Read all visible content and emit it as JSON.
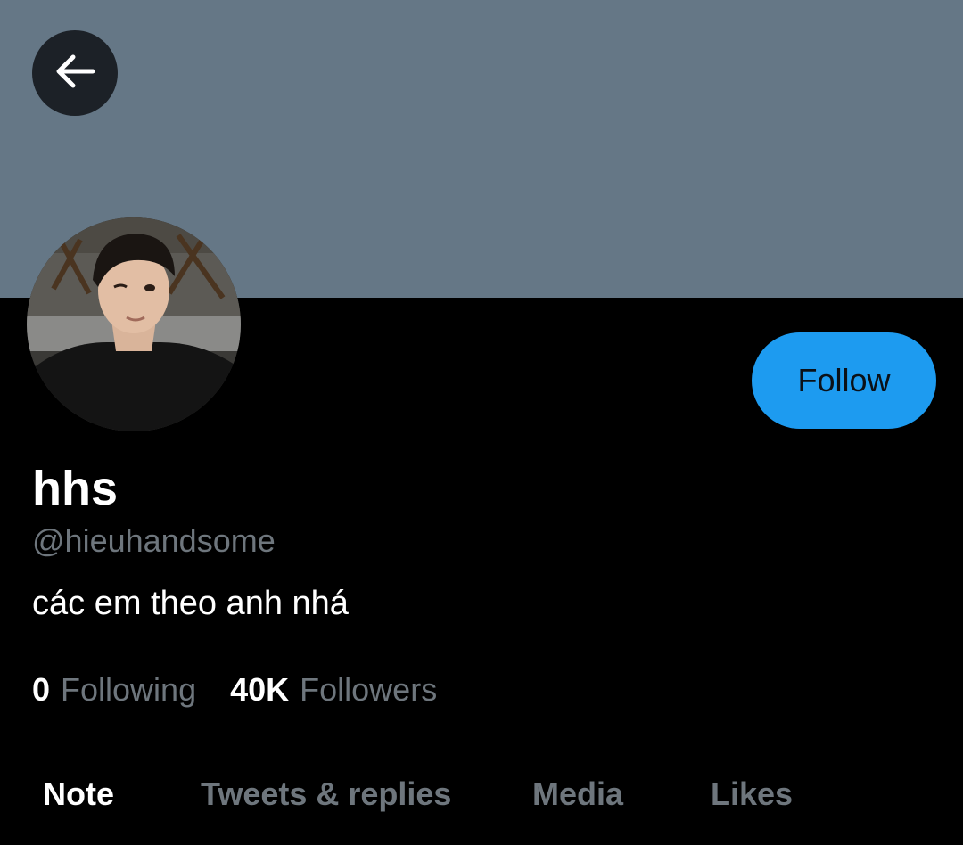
{
  "profile": {
    "display_name": "hhs",
    "handle": "@hieuhandsome",
    "bio": "các em theo anh nhá",
    "banner_color": "#657786"
  },
  "actions": {
    "follow_label": "Follow",
    "follow_color": "#1d9bf0"
  },
  "stats": {
    "following_count": "0",
    "following_label": "Following",
    "followers_count": "40K",
    "followers_label": "Followers"
  },
  "tabs": [
    {
      "label": "Note",
      "active": true
    },
    {
      "label": "Tweets & replies",
      "active": false
    },
    {
      "label": "Media",
      "active": false
    },
    {
      "label": "Likes",
      "active": false
    }
  ],
  "icons": {
    "back": "arrow-left-icon"
  },
  "colors": {
    "background": "#000000",
    "muted_text": "#6e767d",
    "primary_text": "#ffffff"
  }
}
